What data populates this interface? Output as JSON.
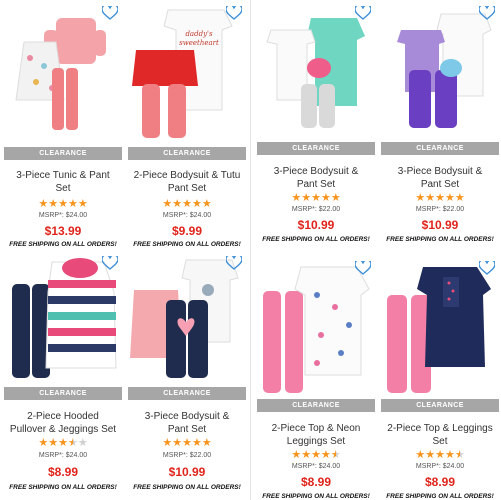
{
  "badge_label": "CLEARANCE",
  "shipping_label": "FREE SHIPPING ON ALL ORDERS!",
  "colors": {
    "price": "#e0241b",
    "star": "#f7941d",
    "badge": "#a6a6a6",
    "heart": "#3d8fd8"
  },
  "products": [
    {
      "name_line1": "3-Piece Tunic & Pant",
      "name_line2": "Set",
      "rating": 5,
      "msrp": "MSRP*: $24.00",
      "price": "$13.99"
    },
    {
      "name_line1": "2-Piece Bodysuit & Tutu",
      "name_line2": "Pant Set",
      "rating": 5,
      "msrp": "MSRP*: $24.00",
      "price": "$9.99"
    },
    {
      "name_line1": "2-Piece Hooded",
      "name_line2": "Pullover & Jeggings Set",
      "rating": 3.5,
      "msrp": "MSRP*: $24.00",
      "price": "$8.99"
    },
    {
      "name_line1": "3-Piece Bodysuit &",
      "name_line2": "Pant Set",
      "rating": 5,
      "msrp": "MSRP*: $22.00",
      "price": "$10.99"
    },
    {
      "name_line1": "3-Piece Bodysuit &",
      "name_line2": "Pant Set",
      "rating": 5,
      "msrp": "MSRP*: $22.00",
      "price": "$10.99"
    },
    {
      "name_line1": "3-Piece Bodysuit &",
      "name_line2": "Pant Set",
      "rating": 5,
      "msrp": "MSRP*: $22.00",
      "price": "$10.99"
    },
    {
      "name_line1": "2-Piece Top & Neon",
      "name_line2": "Leggings Set",
      "rating": 4.5,
      "msrp": "MSRP*: $24.00",
      "price": "$8.99"
    },
    {
      "name_line1": "2-Piece Top & Leggings",
      "name_line2": "Set",
      "rating": 4.5,
      "msrp": "MSRP*: $24.00",
      "price": "$8.99"
    }
  ]
}
